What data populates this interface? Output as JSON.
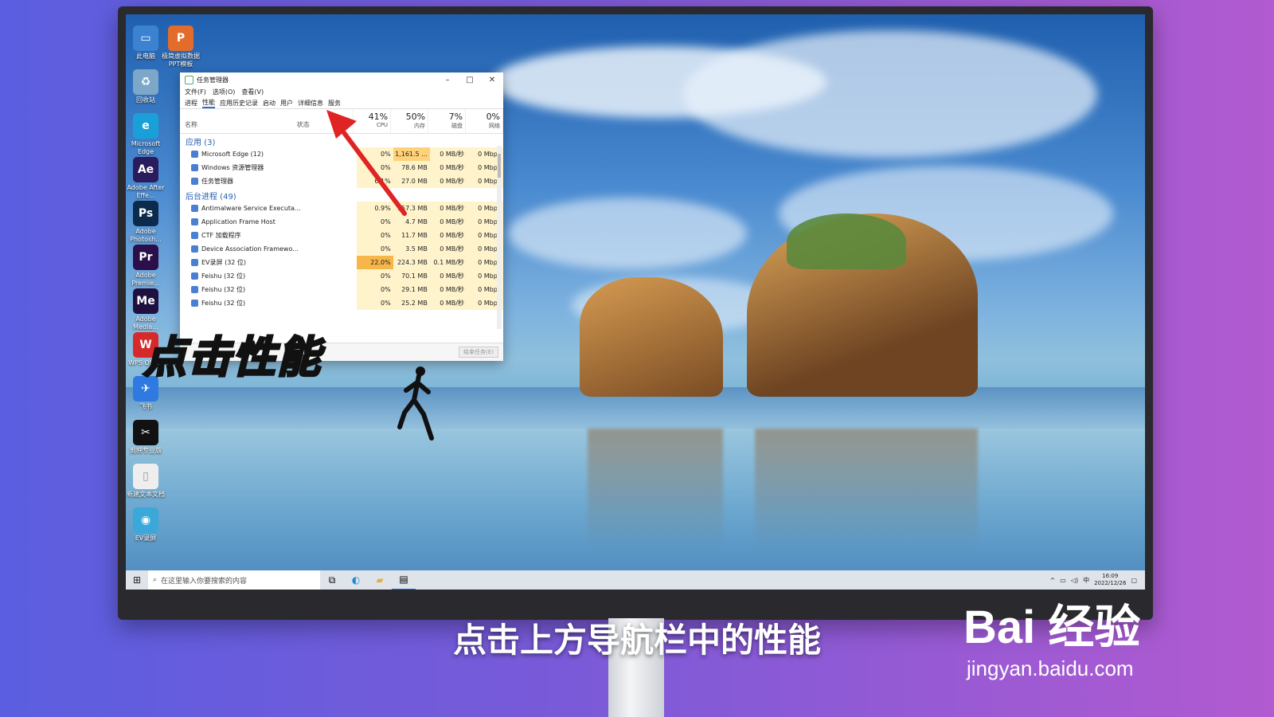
{
  "overlay_caption": "点击性能",
  "subtitle": "点击上方导航栏中的性能",
  "watermark": {
    "brand": "Bai 经验",
    "url": "jingyan.baidu.com"
  },
  "desktop_icons": [
    {
      "label": "此电脑",
      "color": "#3b82d0",
      "glyph": "▭"
    },
    {
      "label": "回收站",
      "color": "#7da7c9",
      "glyph": "♻"
    },
    {
      "label": "Microsoft Edge",
      "color": "#1aa0d8",
      "glyph": "e"
    },
    {
      "label": "Adobe After Effe...",
      "color": "#2a1b5c",
      "glyph": "Ae"
    },
    {
      "label": "Adobe Photosh...",
      "color": "#0b2a4c",
      "glyph": "Ps"
    },
    {
      "label": "Adobe Premie...",
      "color": "#2a0f4a",
      "glyph": "Pr"
    },
    {
      "label": "Adobe Media...",
      "color": "#1e1140",
      "glyph": "Me"
    },
    {
      "label": "WPS Office",
      "color": "#d62a2a",
      "glyph": "W"
    },
    {
      "label": "飞书",
      "color": "#2f7ae0",
      "glyph": "✈"
    },
    {
      "label": "剪映专业版",
      "color": "#111111",
      "glyph": "✂"
    },
    {
      "label": "新建文本文档",
      "color": "#eeeeee",
      "glyph": "▯"
    },
    {
      "label": "EV录屏",
      "color": "#3aa8d8",
      "glyph": "◉"
    }
  ],
  "desktop_icons_col2": [
    {
      "label": "极简虚拟数据PPT模板",
      "color": "#e36c2a",
      "glyph": "P"
    }
  ],
  "task_manager": {
    "title": "任务管理器",
    "menu": [
      "文件(F)",
      "选项(O)",
      "查看(V)"
    ],
    "tabs": [
      "进程",
      "性能",
      "应用历史记录",
      "启动",
      "用户",
      "详细信息",
      "服务"
    ],
    "active_tab": "性能",
    "columns": {
      "name": "名称",
      "status": "状态",
      "cpu": {
        "pct": "41%",
        "label": "CPU"
      },
      "mem": {
        "pct": "50%",
        "label": "内存"
      },
      "disk": {
        "pct": "7%",
        "label": "磁盘"
      },
      "net": {
        "pct": "0%",
        "label": "网络"
      }
    },
    "sections": [
      {
        "title": "应用 (3)",
        "rows": [
          {
            "name": "Microsoft Edge (12)",
            "cpu": "0%",
            "mem": "1,161.5 ...",
            "disk": "0 MB/秒",
            "net": "0 Mbps",
            "memhot": true
          },
          {
            "name": "Windows 资源管理器",
            "cpu": "0%",
            "mem": "78.6 MB",
            "disk": "0 MB/秒",
            "net": "0 Mbps"
          },
          {
            "name": "任务管理器",
            "cpu": "6.1%",
            "mem": "27.0 MB",
            "disk": "0 MB/秒",
            "net": "0 Mbps"
          }
        ]
      },
      {
        "title": "后台进程 (49)",
        "rows": [
          {
            "name": "Antimalware Service Executa...",
            "cpu": "0.9%",
            "mem": "157.3 MB",
            "disk": "0 MB/秒",
            "net": "0 Mbps"
          },
          {
            "name": "Application Frame Host",
            "cpu": "0%",
            "mem": "4.7 MB",
            "disk": "0 MB/秒",
            "net": "0 Mbps"
          },
          {
            "name": "CTF 加载程序",
            "cpu": "0%",
            "mem": "11.7 MB",
            "disk": "0 MB/秒",
            "net": "0 Mbps"
          },
          {
            "name": "Device Association Framewo...",
            "cpu": "0%",
            "mem": "3.5 MB",
            "disk": "0 MB/秒",
            "net": "0 Mbps"
          },
          {
            "name": "EV录屏 (32 位)",
            "cpu": "22.0%",
            "mem": "224.3 MB",
            "disk": "0.1 MB/秒",
            "net": "0 Mbps",
            "cpuhot": true
          },
          {
            "name": "Feishu (32 位)",
            "cpu": "0%",
            "mem": "70.1 MB",
            "disk": "0 MB/秒",
            "net": "0 Mbps"
          },
          {
            "name": "Feishu (32 位)",
            "cpu": "0%",
            "mem": "29.1 MB",
            "disk": "0 MB/秒",
            "net": "0 Mbps"
          },
          {
            "name": "Feishu (32 位)",
            "cpu": "0%",
            "mem": "25.2 MB",
            "disk": "0 MB/秒",
            "net": "0 Mbps"
          }
        ]
      }
    ],
    "end_task": "结束任务(E)"
  },
  "taskbar": {
    "search_placeholder": "在这里输入你要搜索的内容",
    "clock_time": "16:09",
    "clock_date": "2022/12/26",
    "ime": "中"
  }
}
